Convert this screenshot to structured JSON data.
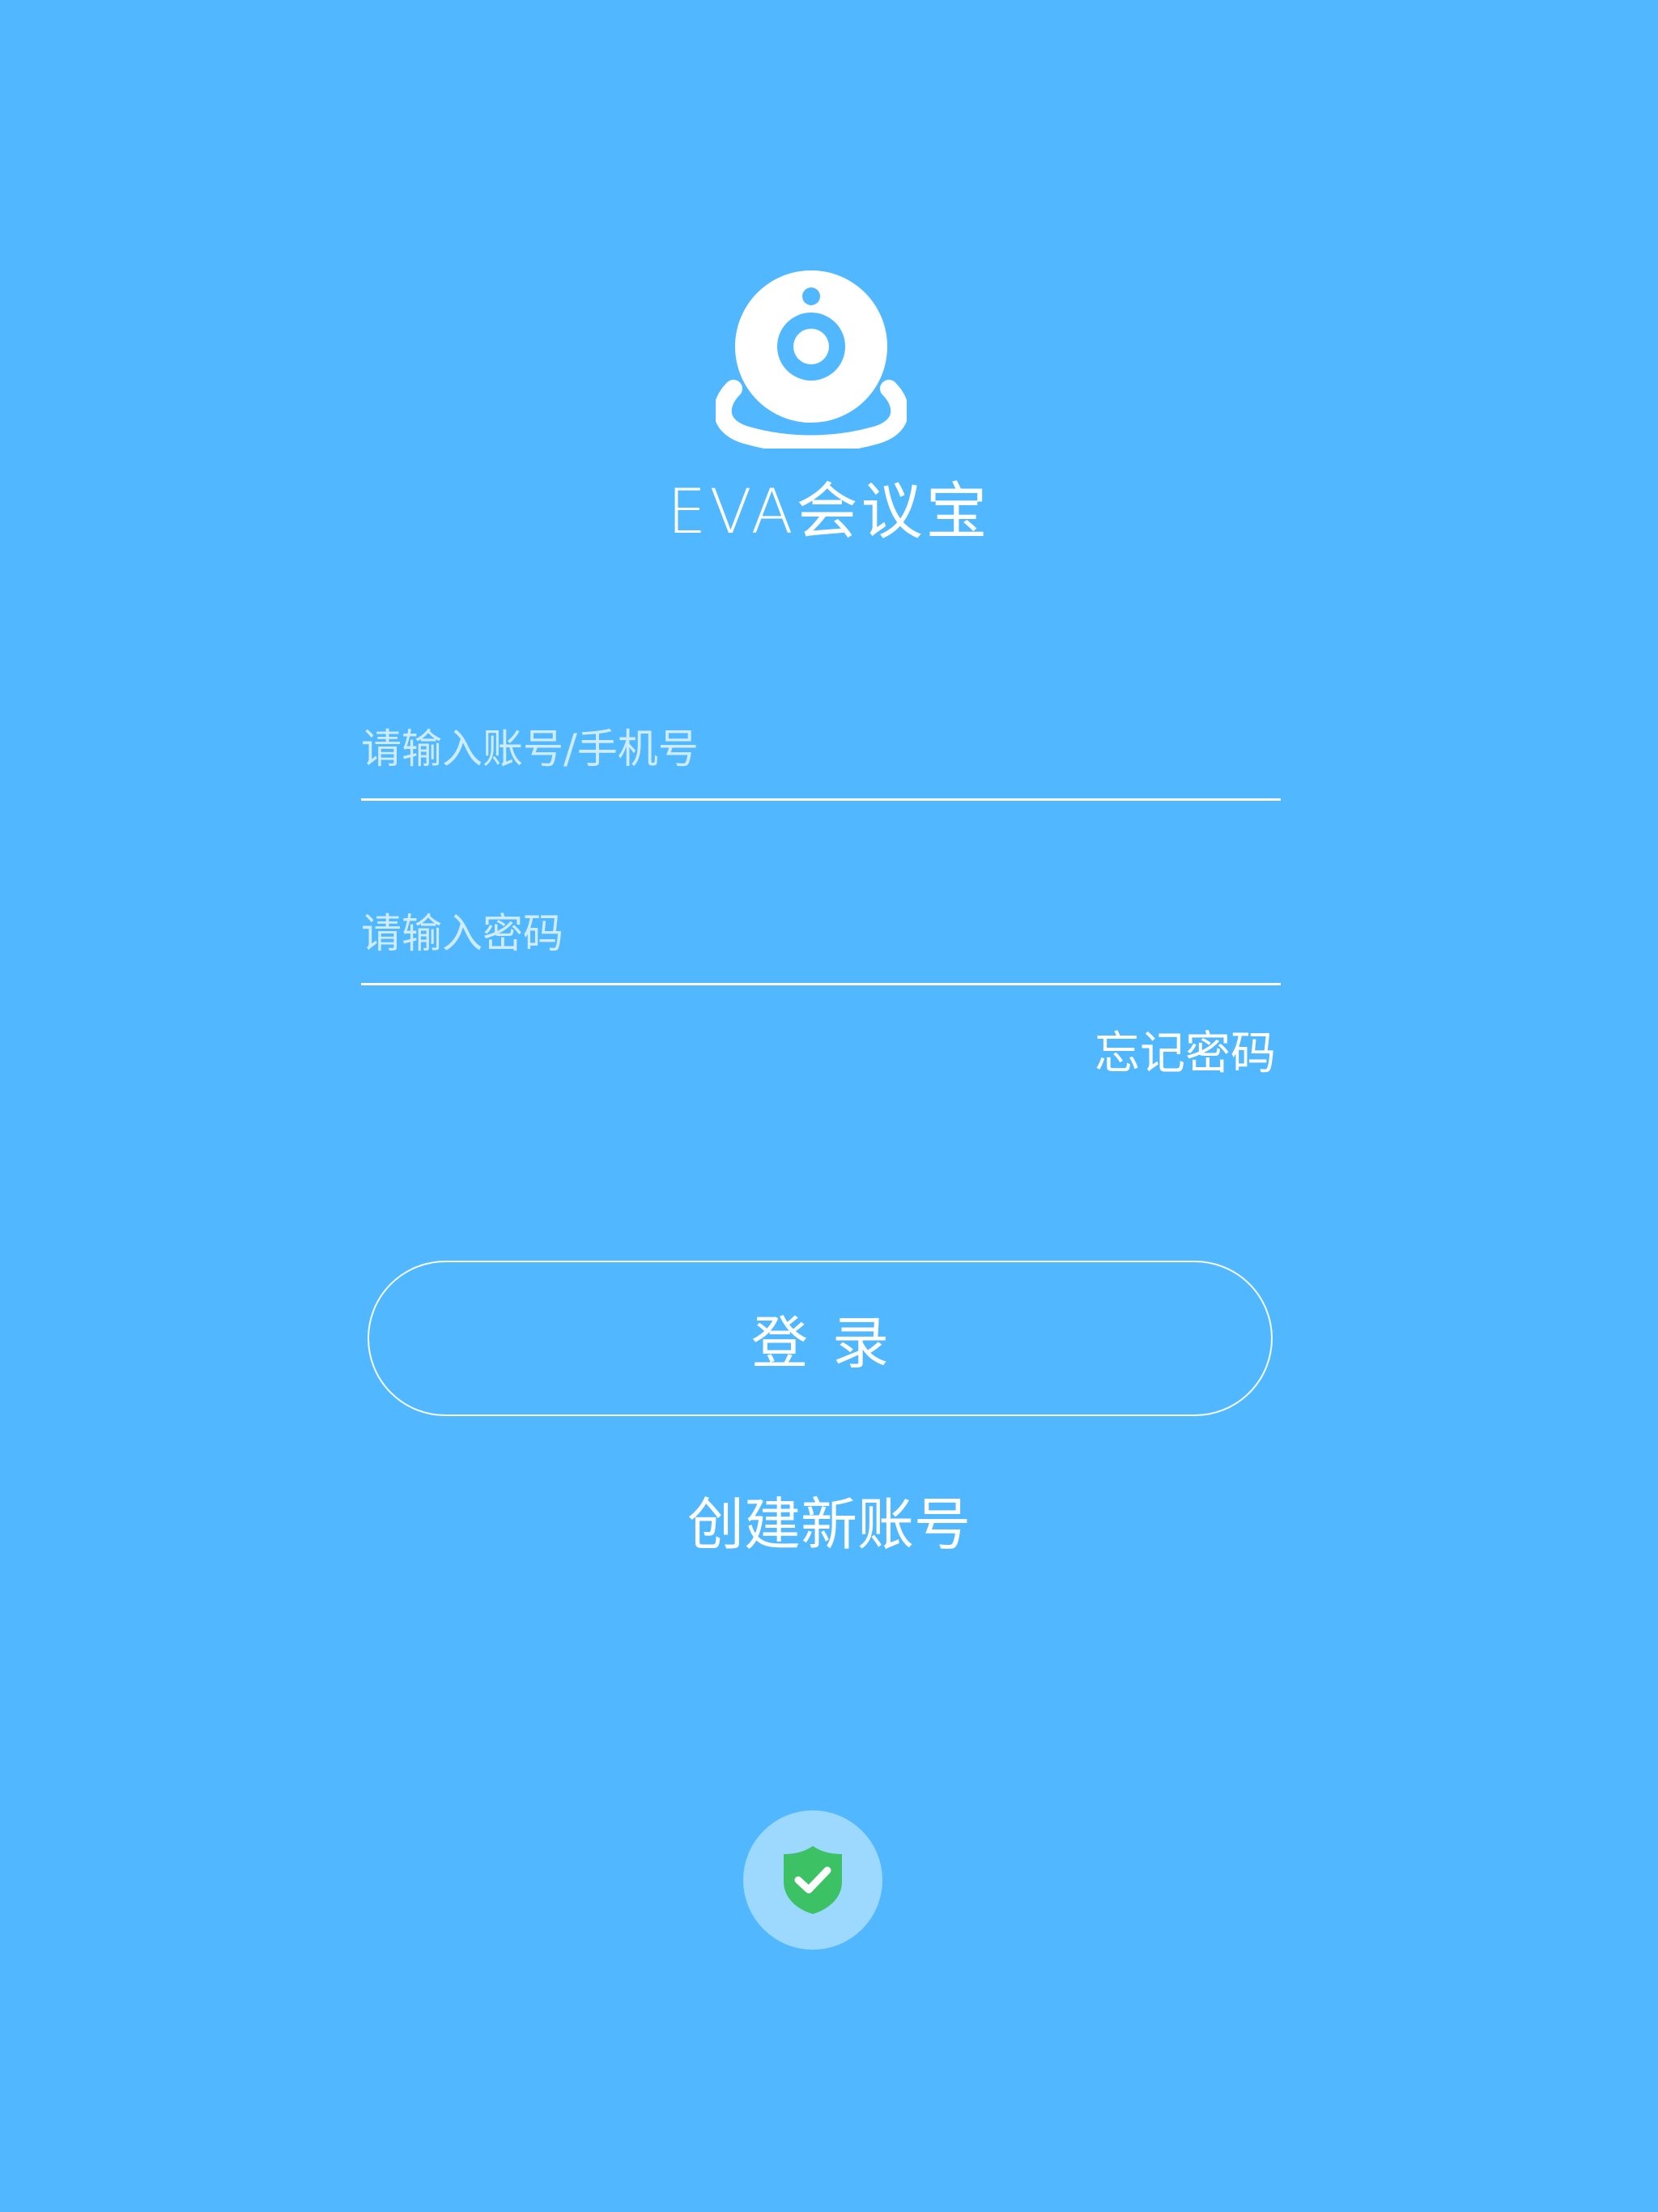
{
  "app": {
    "title": "EVA会议宝"
  },
  "login_form": {
    "account_placeholder": "请输入账号/手机号",
    "account_value": "",
    "password_placeholder": "请输入密码",
    "password_value": "",
    "forgot_password_label": "忘记密码",
    "login_button_label": "登录",
    "create_account_label": "创建新账号"
  },
  "icons": {
    "logo": "webcam-logo-icon",
    "security": "shield-check-icon"
  },
  "colors": {
    "background": "#51b8ff",
    "foreground": "#ffffff",
    "badge_background": "#9dd8ff",
    "shield": "#3cc264"
  }
}
